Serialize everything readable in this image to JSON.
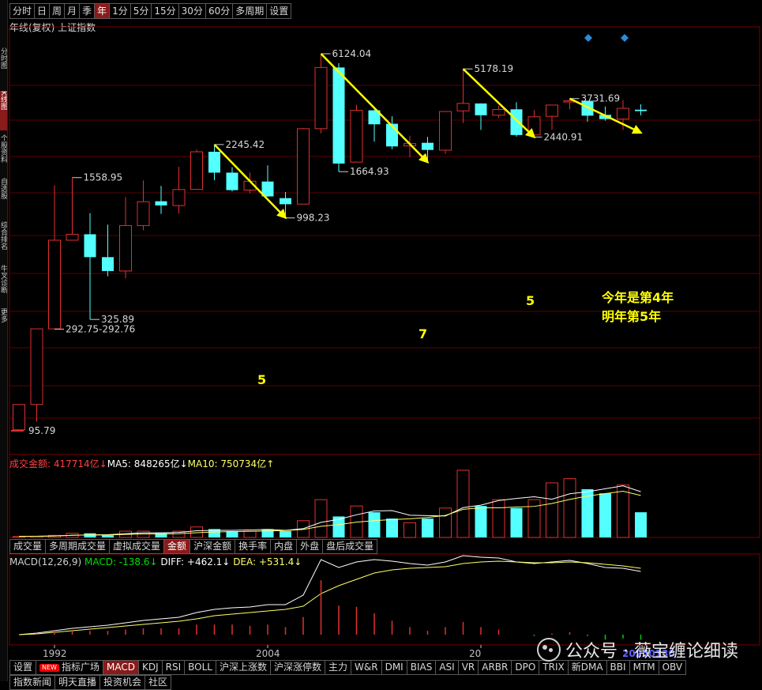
{
  "left_strip": [
    "分时图",
    "K线图",
    "个股资料",
    "自选股",
    "综合排名",
    "牛叉诊断",
    "更多"
  ],
  "period_tabs": [
    "分时",
    "日",
    "周",
    "月",
    "季",
    "年",
    "1分",
    "5分",
    "15分",
    "30分",
    "60分",
    "多周期",
    "设置"
  ],
  "active_period": "年",
  "chart_title": "年线(复权)  上证指数",
  "colors": {
    "up": "#e03030",
    "down": "#54ffff",
    "ann": "#ffff00",
    "ma5": "#ffffff",
    "ma10": "#ffff66",
    "grid": "#7a0000"
  },
  "price_labels": {
    "p6124": "6124.04",
    "p5178": "5178.19",
    "p3731": "3731.69",
    "p2440": "2440.91",
    "p1664": "1664.93",
    "p2245": "2245.42",
    "p998": "998.23",
    "p1558": "1558.95",
    "p325": "325.89",
    "p292": "292.75-292.76",
    "p95": "95.79"
  },
  "annotations": {
    "n5a": "5",
    "n7": "7",
    "n5b": "5",
    "note1": "今年是第4年",
    "note2": "明年第5年"
  },
  "chart_data": {
    "type": "candlestick",
    "x": [
      1990,
      1991,
      1992,
      1993,
      1994,
      1995,
      1996,
      1997,
      1998,
      1999,
      2000,
      2001,
      2002,
      2003,
      2004,
      2005,
      2006,
      2007,
      2008,
      2009,
      2010,
      2011,
      2012,
      2013,
      2014,
      2015,
      2016,
      2017,
      2018,
      2019,
      2020,
      2021,
      2022,
      2023,
      2024,
      2025
    ],
    "open": [
      96,
      127,
      293,
      780,
      833,
      647,
      555,
      917,
      1200,
      1144,
      1368,
      2073,
      1646,
      1358,
      1492,
      1242,
      1163,
      2675,
      5262,
      1849,
      3277,
      2825,
      2212,
      2289,
      2109,
      3258,
      3536,
      3105,
      3314,
      2497,
      3066,
      3640,
      3639,
      3117,
      2975,
      3300
    ],
    "high": [
      127,
      293,
      1430,
      1558,
      1053,
      926,
      1258,
      1510,
      1422,
      1756,
      2125,
      2245,
      1748,
      1649,
      1783,
      1328,
      2698,
      6124,
      5522,
      3478,
      3306,
      3067,
      2478,
      2444,
      3239,
      5178,
      3539,
      3450,
      3587,
      3288,
      3474,
      3731,
      3651,
      3418,
      3674,
      3500
    ],
    "low": [
      96,
      105,
      293,
      780,
      325,
      524,
      512,
      870,
      1043,
      1047,
      1361,
      1514,
      1339,
      1311,
      1259,
      998,
      1161,
      2541,
      1664,
      1844,
      2319,
      2134,
      1949,
      1849,
      2024,
      2850,
      2638,
      3016,
      2449,
      2440,
      2646,
      3312,
      2885,
      2923,
      2635,
      3100
    ],
    "close": [
      127,
      293,
      780,
      833,
      647,
      555,
      917,
      1194,
      1146,
      1366,
      2073,
      1646,
      1357,
      1497,
      1266,
      1161,
      2675,
      5261,
      1820,
      3277,
      2808,
      2199,
      2269,
      2116,
      3235,
      3539,
      3104,
      3307,
      2494,
      3050,
      3473,
      3640,
      3089,
      2975,
      3351,
      3250
    ],
    "amount_series": [
      {
        "name": "MA5",
        "value": "848265亿"
      },
      {
        "name": "MA10",
        "value": "750734亿"
      }
    ],
    "amount_label": "成交金额: 417714亿",
    "macd": {
      "label": "MACD(12,26,9)",
      "macd": "MACD: -138.6",
      "diff": "DIFF: +462.1",
      "dea": "DEA: +531.4"
    },
    "x_ticks": [
      "1992",
      "2004",
      "20"
    ]
  },
  "lower_tabs": [
    "成交量",
    "多周期成交量",
    "虚拟成交量",
    "金额",
    "沪深金额",
    "换手率",
    "内盘",
    "外盘",
    "盘后成交量"
  ],
  "active_lower_tab": "金额",
  "indicator_tabs": [
    "设置",
    "指标广场",
    "MACD",
    "KDJ",
    "RSI",
    "BOLL",
    "沪深上涨数",
    "沪深涨停数",
    "主力",
    "W&R",
    "DMI",
    "BIAS",
    "ASI",
    "VR",
    "ARBR",
    "DPO",
    "TRIX",
    "新DMA",
    "BBI",
    "MTM",
    "OBV"
  ],
  "new_badge": "NEW",
  "active_indicator": "MACD",
  "bottom_tabs": [
    "指数新闻",
    "明天直播",
    "投资机会",
    "社区"
  ],
  "watermark": "公众号 · 薇宝缠论细读",
  "watermark_tag": "20250130"
}
